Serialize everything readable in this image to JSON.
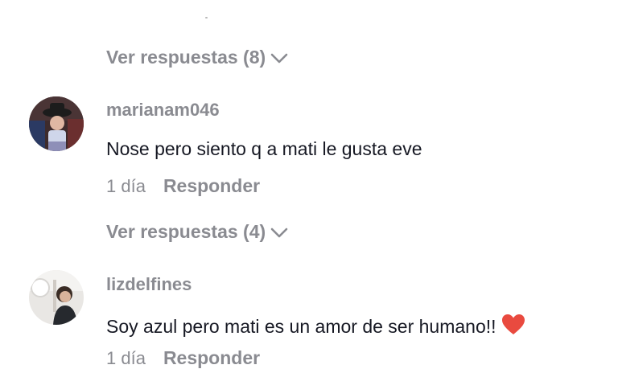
{
  "thread": {
    "replies_toggle_1": {
      "label": "Ver respuestas (8)"
    },
    "comments": [
      {
        "username": "marianam046",
        "text": "Nose pero siento q a mati le gusta eve",
        "date": "1 día",
        "reply_label": "Responder"
      },
      {
        "username": "lizdelfines",
        "text": "Soy azul pero mati es un amor de ser humano!!",
        "emoji": "heart-emoji",
        "date": "1 día",
        "reply_label": "Responder"
      }
    ],
    "replies_toggle_2": {
      "label": "Ver respuestas (4)"
    }
  },
  "colors": {
    "muted_text": "#8a8b91",
    "primary_text": "#161823",
    "heart": "#e94a3f",
    "background": "#ffffff"
  }
}
